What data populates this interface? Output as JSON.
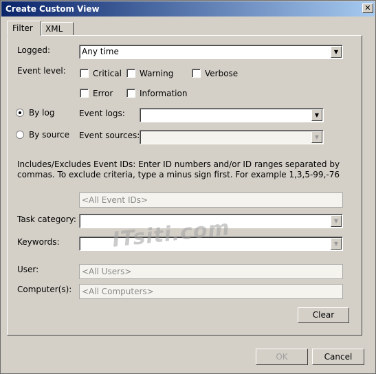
{
  "window": {
    "title": "Create Custom View",
    "close_glyph": "✕"
  },
  "tabs": {
    "filter": "Filter",
    "xml": "XML"
  },
  "logged": {
    "label": "Logged:",
    "value": "Any time"
  },
  "event_level": {
    "label": "Event level:",
    "critical": "Critical",
    "warning": "Warning",
    "verbose": "Verbose",
    "error": "Error",
    "information": "Information"
  },
  "by_log": {
    "label": "By log",
    "selected": true,
    "field_label": "Event logs:",
    "value": ""
  },
  "by_source": {
    "label": "By source",
    "selected": false,
    "field_label": "Event sources:",
    "value": ""
  },
  "event_ids": {
    "description": "Includes/Excludes Event IDs: Enter ID numbers and/or ID ranges separated by commas. To exclude criteria, type a minus sign first. For example 1,3,5-99,-76",
    "placeholder": "<All Event IDs>"
  },
  "task_category": {
    "label": "Task category:",
    "value": ""
  },
  "keywords": {
    "label": "Keywords:",
    "value": ""
  },
  "user": {
    "label": "User:",
    "placeholder": "<All Users>"
  },
  "computers": {
    "label": "Computer(s):",
    "placeholder": "<All Computers>"
  },
  "buttons": {
    "clear": "Clear",
    "ok": "OK",
    "cancel": "Cancel"
  },
  "watermark": "ITsiti.com"
}
